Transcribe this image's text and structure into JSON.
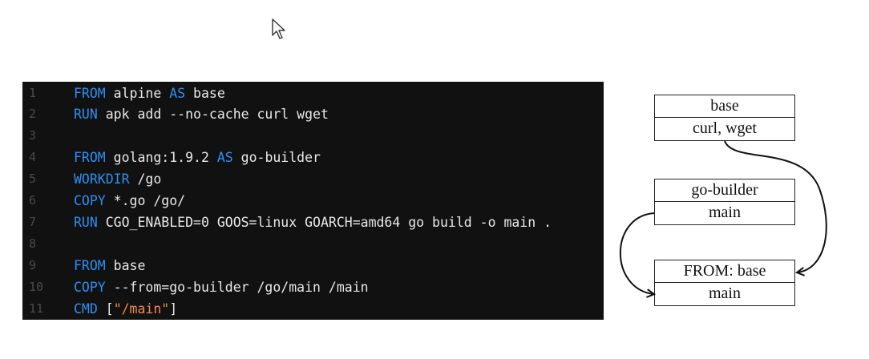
{
  "code": {
    "lines": [
      {
        "n": "1",
        "tokens": [
          {
            "t": "FROM",
            "c": "kw"
          },
          {
            "t": " alpine ",
            "c": "plain"
          },
          {
            "t": "AS",
            "c": "kw"
          },
          {
            "t": " base",
            "c": "plain"
          }
        ]
      },
      {
        "n": "2",
        "tokens": [
          {
            "t": "RUN",
            "c": "kw"
          },
          {
            "t": " apk add --no-cache curl wget",
            "c": "plain"
          }
        ]
      },
      {
        "n": "3",
        "tokens": []
      },
      {
        "n": "4",
        "tokens": [
          {
            "t": "FROM",
            "c": "kw"
          },
          {
            "t": " golang:1.9.2 ",
            "c": "plain"
          },
          {
            "t": "AS",
            "c": "kw"
          },
          {
            "t": " go-builder",
            "c": "plain"
          }
        ]
      },
      {
        "n": "5",
        "tokens": [
          {
            "t": "WORKDIR",
            "c": "kw"
          },
          {
            "t": " /go",
            "c": "plain"
          }
        ]
      },
      {
        "n": "6",
        "tokens": [
          {
            "t": "COPY",
            "c": "kw"
          },
          {
            "t": " *.go /go/",
            "c": "plain"
          }
        ]
      },
      {
        "n": "7",
        "tokens": [
          {
            "t": "RUN",
            "c": "kw"
          },
          {
            "t": " CGO_ENABLED=0 GOOS=linux GOARCH=amd64 go build -o main .",
            "c": "plain"
          }
        ]
      },
      {
        "n": "8",
        "tokens": []
      },
      {
        "n": "9",
        "tokens": [
          {
            "t": "FROM",
            "c": "kw"
          },
          {
            "t": " base",
            "c": "plain"
          }
        ]
      },
      {
        "n": "10",
        "tokens": [
          {
            "t": "COPY",
            "c": "kw"
          },
          {
            "t": " --from=go-builder /go/main /main",
            "c": "plain"
          }
        ]
      },
      {
        "n": "11",
        "tokens": [
          {
            "t": "CMD",
            "c": "kw"
          },
          {
            "t": " [",
            "c": "plain"
          },
          {
            "t": "\"/main\"",
            "c": "str"
          },
          {
            "t": "]",
            "c": "plain"
          }
        ]
      }
    ]
  },
  "diagram": {
    "base_stage": {
      "top": "base",
      "bottom": "curl, wget"
    },
    "builder_stage": {
      "top": "go-builder",
      "bottom": "main"
    },
    "final_stage": {
      "top": "FROM: base",
      "bottom": "main"
    }
  }
}
